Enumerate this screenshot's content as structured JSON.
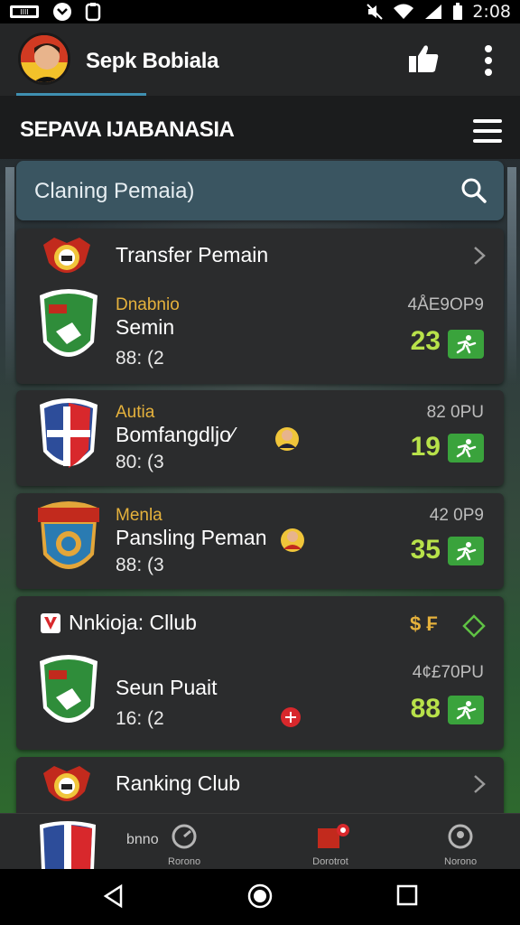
{
  "status_bar": {
    "time": "2:08"
  },
  "app_bar": {
    "title": "Sepk Bobiala"
  },
  "section": {
    "title": "SEPAVA IJABANASIA"
  },
  "search": {
    "placeholder": "Claning Pemaia)"
  },
  "transfer_card": {
    "header": "Transfer Pemain",
    "players": [
      {
        "category": "Dnabnio",
        "name": "Semin",
        "sub": "88: (2",
        "price": "4ÅE9OP9",
        "score": "23"
      },
      {
        "category": "Autia",
        "name": "Bomfangdljo⁄",
        "sub": "80: (3",
        "price": "82 0PU",
        "score": "19"
      },
      {
        "category": "Menla",
        "name": "Pansling Peman",
        "sub": "88: (3",
        "price": "42 0P9",
        "score": "35"
      }
    ]
  },
  "ranking_card": {
    "header": "Nnkioja: Cllub",
    "currency_label": "$ ₣",
    "player": {
      "name": "Seun Puait",
      "sub": "16: (2",
      "price": "4¢£70PU",
      "score": "88"
    }
  },
  "ranking_row": {
    "title": "Ranking Club"
  },
  "bottom_nav": {
    "items": [
      {
        "label": "bnno"
      },
      {
        "label": "Rorono"
      },
      {
        "label": "Dorotrot"
      },
      {
        "label": "Norono"
      }
    ]
  },
  "colors": {
    "accent": "#3aa33c",
    "score": "#b8e24a",
    "category": "#e6b23c",
    "search_bg": "#3a5561"
  }
}
